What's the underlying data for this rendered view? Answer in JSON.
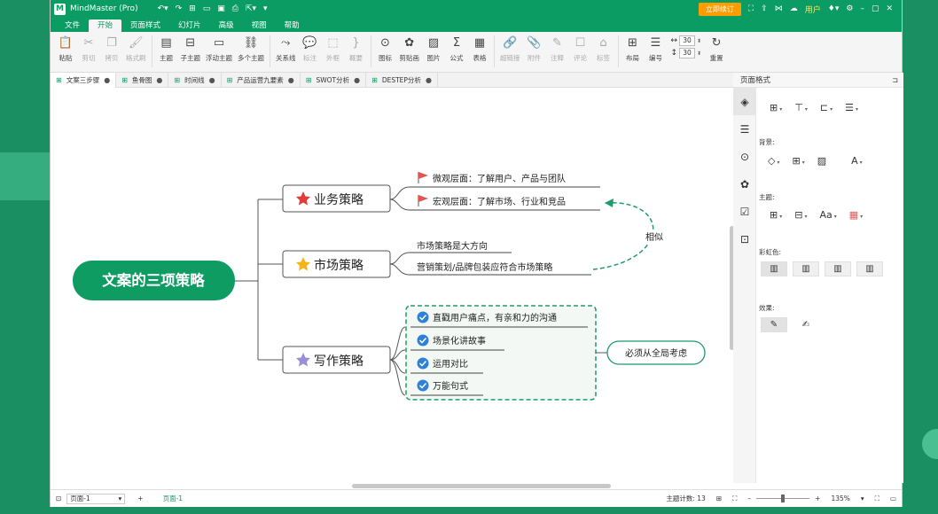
{
  "app": {
    "title": "MindMaster (Pro)",
    "upgrade": "立即续订",
    "user": "用户"
  },
  "menu": [
    "文件",
    "开始",
    "页面样式",
    "幻灯片",
    "高级",
    "视图",
    "帮助"
  ],
  "ribbon": {
    "paste": "粘贴",
    "cut": "剪切",
    "copy": "拷贝",
    "format_painter": "格式刷",
    "topic": "主题",
    "subtopic": "子主题",
    "float_topic": "浮动主题",
    "multi_topic": "多个主题",
    "relation": "关系线",
    "callout": "标注",
    "boundary": "外框",
    "summary": "概要",
    "icon": "图标",
    "clipart": "剪贴画",
    "picture": "图片",
    "formula": "公式",
    "table": "表格",
    "hyperlink": "超链接",
    "attachment": "附件",
    "note": "注释",
    "comment": "评论",
    "tag": "标签",
    "layout": "布局",
    "numbering": "编号",
    "spacing_h": "30",
    "spacing_v": "30",
    "reset": "重置"
  },
  "tabs": [
    "文案三步骤",
    "鱼骨图",
    "时间线",
    "产品运营九要素",
    "SWOT分析",
    "DESTEP分析"
  ],
  "mindmap": {
    "root": "文案的三项策略",
    "branches": [
      {
        "label": "业务策略",
        "items": [
          "微观层面：了解用户、产品与团队",
          "宏观层面：了解市场、行业和竞品"
        ]
      },
      {
        "label": "市场策略",
        "items": [
          "市场策略是大方向",
          "营销策划/品牌包装应符合市场策略"
        ]
      },
      {
        "label": "写作策略",
        "items": [
          "直戳用户痛点，有亲和力的沟通",
          "场景化讲故事",
          "运用对比",
          "万能句式"
        ]
      }
    ],
    "relation_label": "相似",
    "summary": "必须从全局考虑"
  },
  "panel": {
    "title": "页面格式",
    "background": "背景:",
    "theme": "主题:",
    "rainbow": "彩虹色:",
    "effect": "效果:",
    "theme_font": "Aa"
  },
  "status": {
    "page_select": "页面-1",
    "page_tab": "页面-1",
    "topic_count": "主题计数: 13",
    "zoom": "135%"
  },
  "colors": {
    "brand": "#0b9c63",
    "root": "#0e9c62",
    "accent": "#1f9a6d"
  }
}
